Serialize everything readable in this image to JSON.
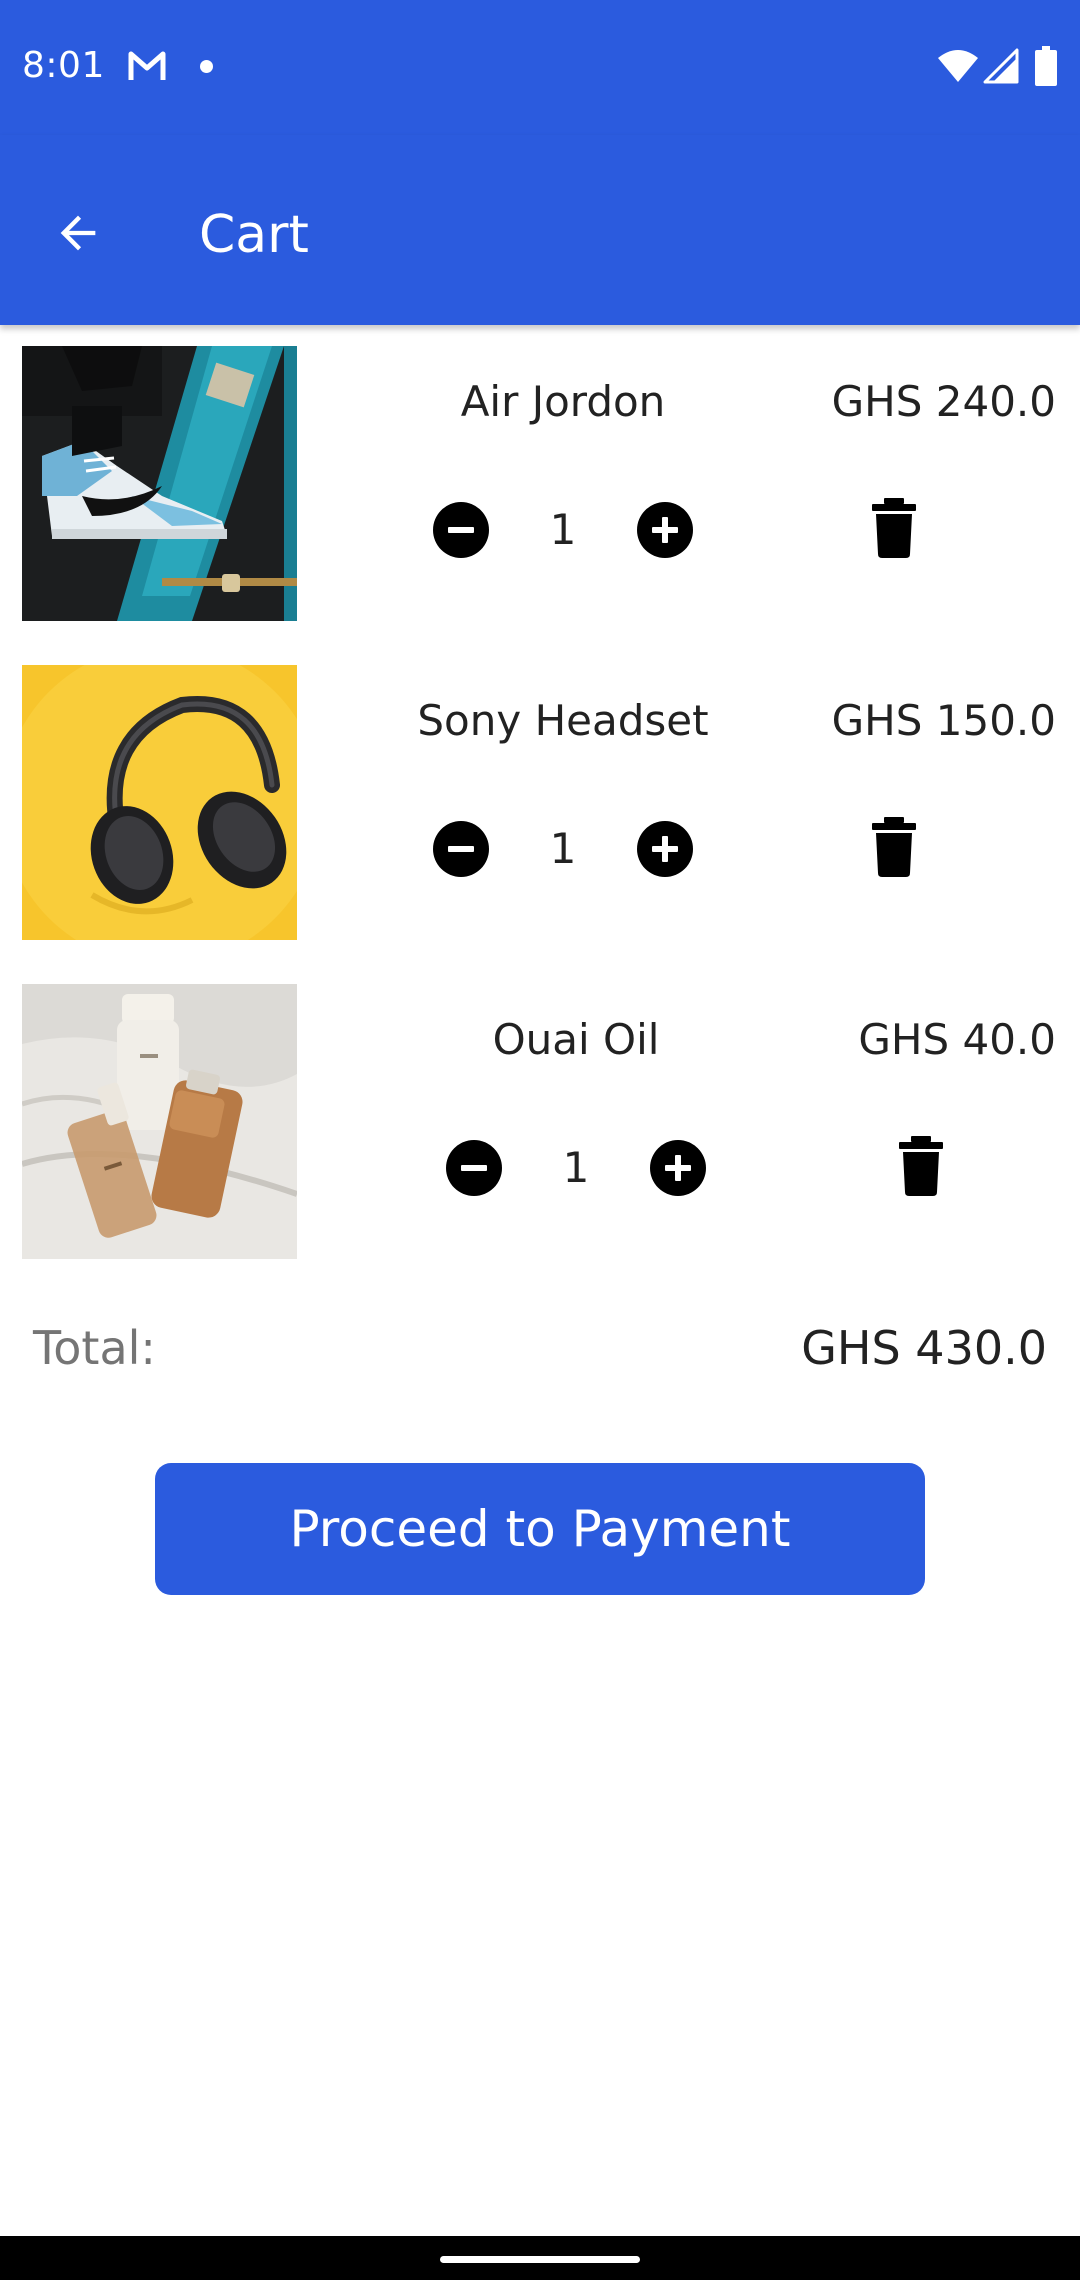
{
  "status_bar": {
    "time": "8:01",
    "icons": [
      "gmail-icon",
      "notification-dot",
      "wifi-icon",
      "signal-icon",
      "battery-icon"
    ]
  },
  "app_bar": {
    "title": "Cart",
    "back_icon": "arrow-back-icon"
  },
  "cart": {
    "items": [
      {
        "name": "Air Jordon",
        "price": "GHS 240.0",
        "quantity": "1",
        "image": "sneakers-photo"
      },
      {
        "name": "Sony Headset",
        "price": "GHS 150.0",
        "quantity": "1",
        "image": "headphones-photo"
      },
      {
        "name": "Ouai Oil",
        "price": "GHS 40.0",
        "quantity": "1",
        "image": "oil-bottles-photo"
      }
    ],
    "total_label": "Total:",
    "total_value": "GHS 430.0",
    "pay_button": "Proceed to Payment"
  },
  "colors": {
    "primary": "#2b5bde",
    "text": "#222222",
    "muted": "#757575",
    "icon": "#000000"
  }
}
